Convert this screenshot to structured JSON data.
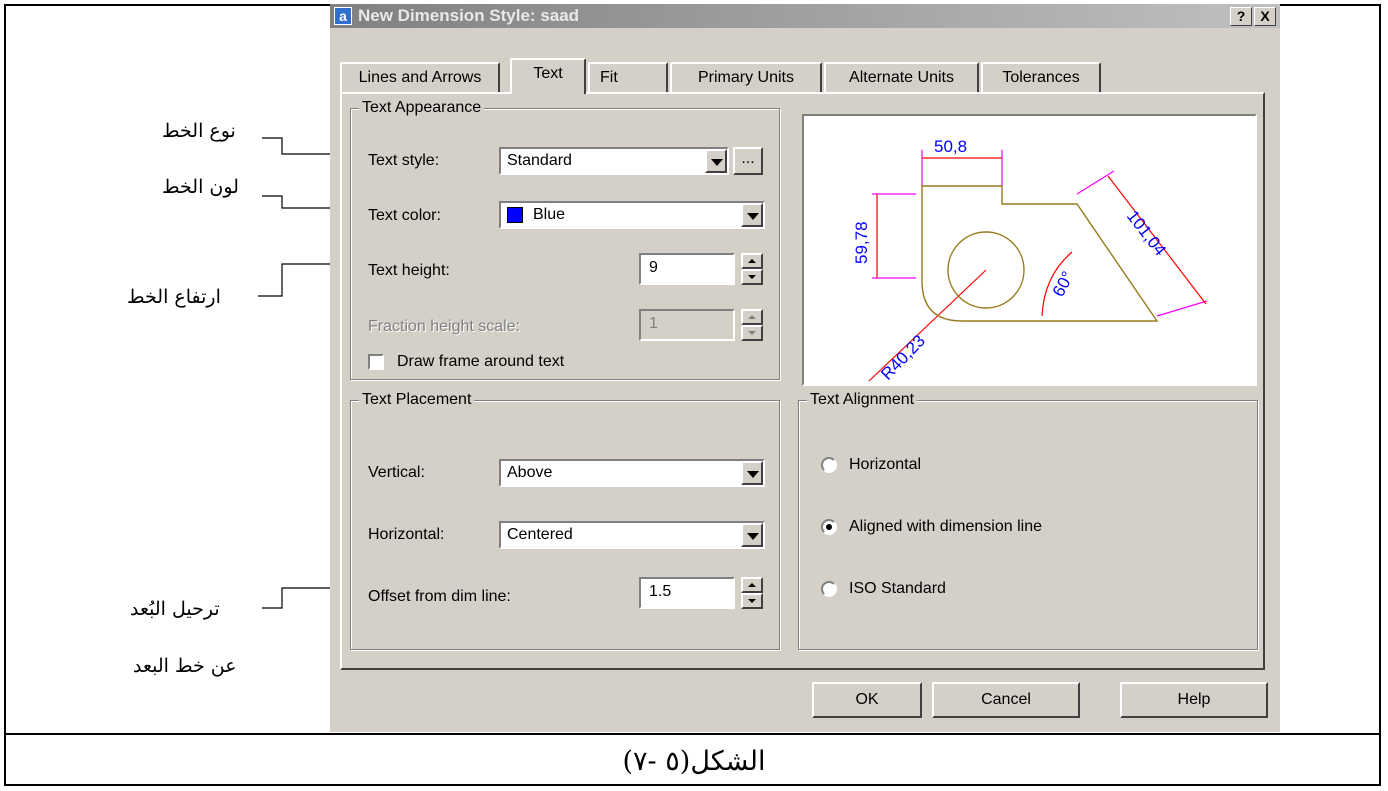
{
  "dialog": {
    "title": "New Dimension Style: saad",
    "app_icon": "a",
    "help_btn": "?",
    "close_btn": "X"
  },
  "tabs": [
    "Lines and Arrows",
    "Text",
    "Fit",
    "Primary Units",
    "Alternate Units",
    "Tolerances"
  ],
  "active_tab": "Text",
  "text_appearance": {
    "title": "Text Appearance",
    "text_style_label": "Text style:",
    "text_style_value": "Standard",
    "browse_button": "...",
    "text_color_label": "Text color:",
    "text_color_value": "Blue",
    "text_color_hex": "#0000ff",
    "text_height_label": "Text height:",
    "text_height_value": "9",
    "fraction_label": "Fraction height scale:",
    "fraction_value": "1",
    "draw_frame_label": "Draw frame around text"
  },
  "preview": {
    "dim_top": "50,8",
    "dim_left": "59,78",
    "dim_slant": "101,04",
    "dim_angle": "60°",
    "dim_radius": "R40,23",
    "colors": {
      "outline": "#9a7a1e",
      "dim": "#ff0000",
      "ext": "#ff00ff",
      "text": "#0000ff"
    }
  },
  "text_placement": {
    "title": "Text Placement",
    "vertical_label": "Vertical:",
    "vertical_value": "Above",
    "horizontal_label": "Horizontal:",
    "horizontal_value": "Centered",
    "offset_label": "Offset from dim line:",
    "offset_value": "1.5"
  },
  "text_alignment": {
    "title": "Text Alignment",
    "options": [
      "Horizontal",
      "Aligned with dimension line",
      "ISO Standard"
    ],
    "selected": "Aligned with dimension line"
  },
  "buttons": {
    "ok": "OK",
    "cancel": "Cancel",
    "help": "Help"
  },
  "annotations": {
    "font_type": "نوع الخط",
    "font_color": "لون الخط",
    "font_height": "ارتفاع الخط",
    "offset_line1": "ترحيل البُعد",
    "offset_line2": "عن خط البعد"
  },
  "caption": "الشكل(٥ -٧)"
}
